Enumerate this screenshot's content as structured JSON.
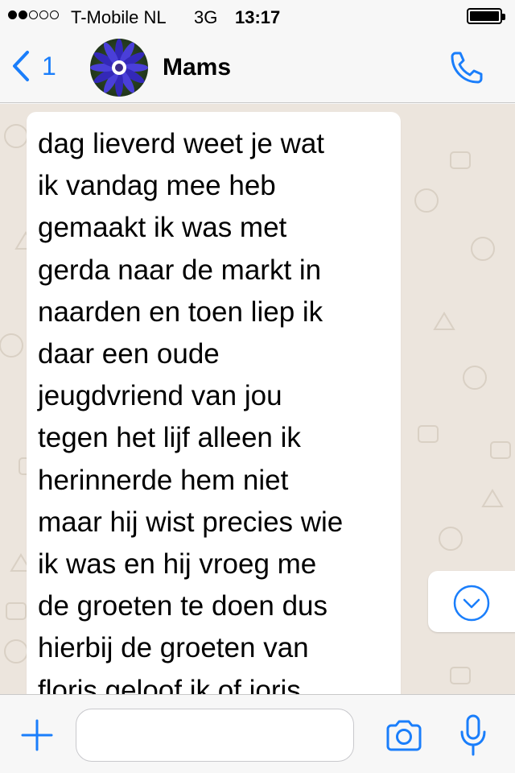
{
  "status_bar": {
    "signal_strength": 2,
    "signal_max": 5,
    "carrier": "T-Mobile NL",
    "network": "3G",
    "time": "13:17",
    "battery_level": 1.0
  },
  "header": {
    "back_count": "1",
    "contact_name": "Mams",
    "icons": {
      "back": "chevron-left-icon",
      "avatar": "flower-avatar",
      "call": "phone-icon"
    }
  },
  "messages": [
    {
      "direction": "incoming",
      "lines": [
        "dag lieverd weet je wat",
        "ik vandag mee heb",
        "gemaakt ik was met",
        "gerda naar de markt in",
        "naarden en toen liep ik",
        "daar een oude",
        "jeugdvriend van jou",
        "tegen het lijf alleen ik",
        "herinnerde hem niet",
        "maar hij wist precies wie",
        "ik was en hij vroeg me",
        "de groeten te doen dus",
        "hierbij de groeten van",
        "floris geloof ik of joris"
      ]
    }
  ],
  "composer": {
    "input_value": "",
    "input_placeholder": "",
    "icons": {
      "attach": "plus-icon",
      "camera": "camera-icon",
      "mic": "microphone-icon",
      "scroll_down": "chevron-down-circle-icon"
    }
  },
  "colors": {
    "accent": "#1a7efb",
    "bar_background": "#f7f7f7",
    "chat_background": "#ece5dd",
    "bubble_incoming": "#ffffff",
    "text": "#000000"
  }
}
